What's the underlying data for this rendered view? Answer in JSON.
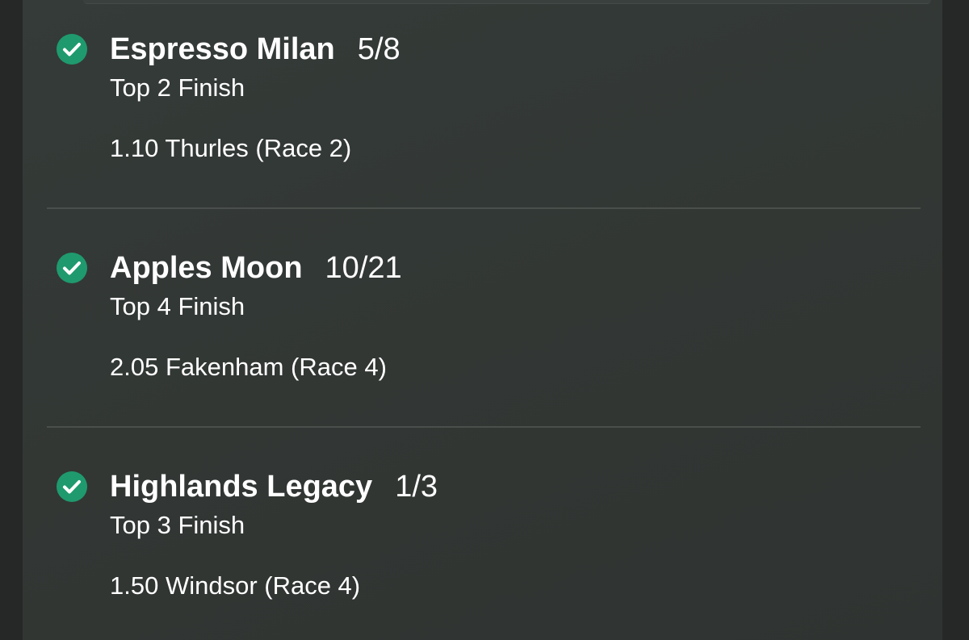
{
  "selections": [
    {
      "horse": "Espresso Milan",
      "odds": "5/8",
      "market": "Top 2 Finish",
      "race": "1.10 Thurles (Race 2)"
    },
    {
      "horse": "Apples Moon",
      "odds": "10/21",
      "market": "Top 4 Finish",
      "race": "2.05 Fakenham (Race 4)"
    },
    {
      "horse": "Highlands Legacy",
      "odds": "1/3",
      "market": "Top 3 Finish",
      "race": "1.50 Windsor (Race 4)"
    }
  ],
  "colors": {
    "background": "#262827",
    "panel": "#333835",
    "check_green": "#1f9a6e",
    "text": "#ffffff",
    "divider": "#4a4f4c"
  },
  "icons": {
    "status": "check-circle-icon"
  }
}
